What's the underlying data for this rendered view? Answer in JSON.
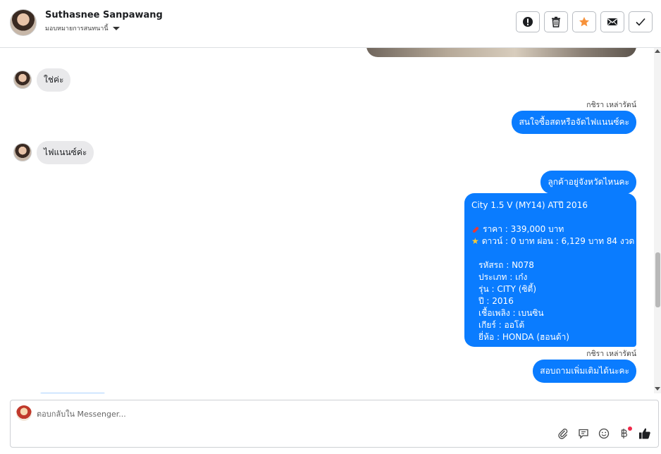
{
  "header": {
    "name": "Suthasnee Sanpawang",
    "assign_label": "มอบหมายการสนทนานี้",
    "actions": [
      {
        "id": "spam",
        "icon": "alert-icon"
      },
      {
        "id": "delete",
        "icon": "trash-icon"
      },
      {
        "id": "star",
        "icon": "star-icon",
        "color": "#f7923b"
      },
      {
        "id": "mail",
        "icon": "mail-icon"
      },
      {
        "id": "done",
        "icon": "check-icon"
      }
    ]
  },
  "messages": [
    {
      "id": "m1",
      "from": "customer",
      "text": "ใช่ค่ะ"
    },
    {
      "id": "m2",
      "from": "page",
      "sender": "กชิรา เหล่ารัตน์",
      "text": "สนใจซื้อสดหรือจัดไฟแนนซ์คะ"
    },
    {
      "id": "m3",
      "from": "customer",
      "text": "ไฟแนนซ์ค่ะ"
    },
    {
      "id": "m4",
      "from": "page",
      "text": "ลูกค้าอยู่จังหวัดไหนคะ"
    },
    {
      "id": "m6",
      "from": "page",
      "sender": "กชิรา เหล่ารัตน์",
      "text": "สอบถามเพิ่มเติมได้นะคะ"
    }
  ],
  "listing": {
    "title": "City 1.5 V (MY14) ATปี 2016",
    "price": "ราคา : 339,000 บาท",
    "payment": "ดาวน์ : 0 บาท ผ่อน : 6,129 บาท 84 งวด",
    "details": [
      "รหัสรถ : N078",
      "ประเภท : เก๋ง",
      "รุ่น : CITY (ซิตี้)",
      "ปี : 2016",
      "เชื้อเพลิง : เบนซิน",
      "เกียร์ : ออโต้",
      "ยี่ห้อ : HONDA (ฮอนด้า)"
    ]
  },
  "composer": {
    "placeholder": "ตอบกลับใน Messenger...",
    "icons": [
      "attach-icon",
      "saved-reply-icon",
      "emoji-icon",
      "baht-icon",
      "like-icon"
    ]
  },
  "colors": {
    "bubble_out": "#0a7cff",
    "bubble_in": "#e9e9eb",
    "accent_star": "#f7923b",
    "notification_dot": "#f02849"
  }
}
